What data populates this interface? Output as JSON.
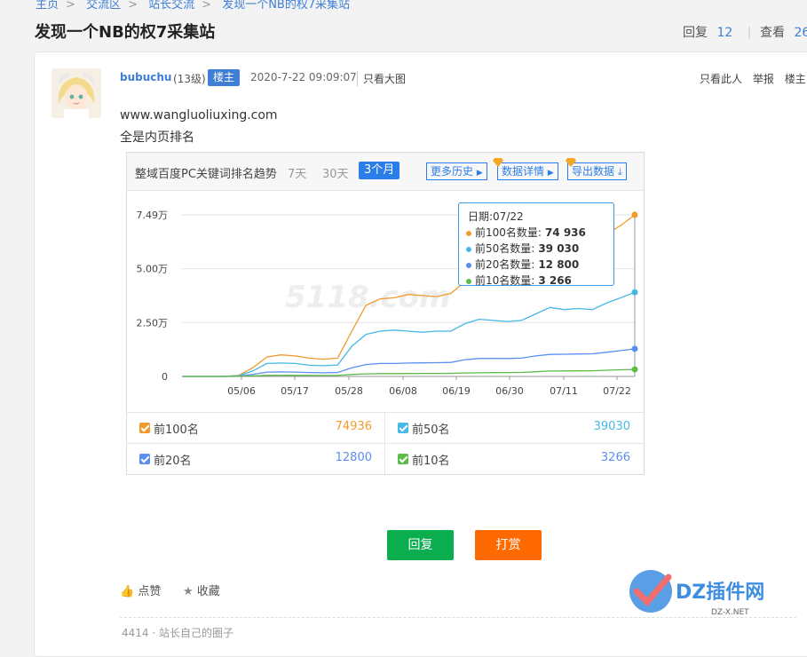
{
  "breadcrumb": [
    "主页",
    "交流区",
    "站长交流",
    "发现一个NB的权7采集站"
  ],
  "thread": {
    "title": "发现一个NB的权7采集站",
    "reply_label": "回复",
    "reply_count": "12",
    "view_label": "查看",
    "view_count": "26"
  },
  "post": {
    "author": "bubuchu",
    "level": "(13级)",
    "owner_badge": "楼主",
    "time": "2020-7-22 09:09:07",
    "view_big": "只看大图",
    "actions": [
      "只看此人",
      "举报",
      "楼主"
    ],
    "lines": [
      "www.wangluoliuxing.com",
      "全是内页排名"
    ]
  },
  "widget": {
    "title": "整域百度PC关键词排名趋势",
    "tabs": [
      "7天",
      "30天",
      "3个月"
    ],
    "active_tab": "3个月",
    "links": [
      "更多历史",
      "数据详情",
      "导出数据"
    ],
    "watermark": "5118.com"
  },
  "chart_data": {
    "type": "line",
    "x_ticks": [
      "05/06",
      "05/17",
      "05/28",
      "06/08",
      "06/19",
      "06/30",
      "07/11",
      "07/22"
    ],
    "y_ticks": [
      "0",
      "2.50万",
      "5.00万",
      "7.49万"
    ],
    "ylim": [
      0,
      74936
    ],
    "x": [
      "04/25",
      "04/30",
      "05/05",
      "05/10",
      "05/13",
      "05/15",
      "05/17",
      "05/19",
      "05/21",
      "05/24",
      "05/26",
      "05/28",
      "05/29",
      "05/31",
      "06/03",
      "06/06",
      "06/09",
      "06/12",
      "06/15",
      "06/17",
      "06/19",
      "06/21",
      "06/24",
      "06/27",
      "06/30",
      "07/02",
      "07/05",
      "07/08",
      "07/11",
      "07/14",
      "07/17",
      "07/20",
      "07/22"
    ],
    "series": [
      {
        "name": "前100名",
        "color": "#f29a2e",
        "values": [
          0,
          0,
          0,
          0,
          500,
          4000,
          9000,
          10000,
          9500,
          8500,
          8000,
          8500,
          21000,
          33000,
          36000,
          36500,
          38000,
          37500,
          37000,
          38500,
          44000,
          46000,
          45000,
          47000,
          48500,
          52000,
          57000,
          60000,
          61000,
          63000,
          66000,
          70000,
          74936
        ]
      },
      {
        "name": "前50名",
        "color": "#45b8e6",
        "values": [
          0,
          0,
          0,
          0,
          300,
          2500,
          6000,
          6200,
          6000,
          5200,
          5000,
          5300,
          14000,
          19500,
          21000,
          21500,
          21000,
          20500,
          21000,
          21000,
          24500,
          26500,
          26000,
          25500,
          26000,
          29000,
          32000,
          31000,
          31500,
          31000,
          34000,
          36500,
          39030
        ]
      },
      {
        "name": "前20名",
        "color": "#5a8ef0",
        "values": [
          0,
          0,
          0,
          0,
          100,
          1000,
          2000,
          2100,
          2000,
          1800,
          1700,
          1800,
          4000,
          5500,
          6000,
          6000,
          6200,
          6300,
          6400,
          6500,
          7800,
          8300,
          8400,
          8300,
          8500,
          9500,
          10200,
          10300,
          10400,
          10500,
          11200,
          12000,
          12800
        ]
      },
      {
        "name": "前10名",
        "color": "#5dbb4a",
        "values": [
          0,
          0,
          0,
          0,
          50,
          300,
          500,
          520,
          510,
          480,
          470,
          480,
          900,
          1200,
          1300,
          1300,
          1350,
          1380,
          1400,
          1450,
          1600,
          1700,
          1750,
          1800,
          1850,
          2200,
          2500,
          2550,
          2600,
          2650,
          2900,
          3100,
          3266
        ]
      }
    ],
    "tooltip": {
      "date_label": "日期:07/22",
      "rows": [
        {
          "label": "前100名数量:",
          "value": "74 936",
          "color": "#f29a2e"
        },
        {
          "label": "前50名数量:",
          "value": "39 030",
          "color": "#45b8e6"
        },
        {
          "label": "前20名数量:",
          "value": "12 800",
          "color": "#5a8ef0"
        },
        {
          "label": "前10名数量:",
          "value": "3 266",
          "color": "#5dbb4a"
        }
      ]
    }
  },
  "legend": [
    {
      "label": "前100名",
      "value": "74936",
      "color": "#f29a2e"
    },
    {
      "label": "前50名",
      "value": "39030",
      "color": "#45b8e6"
    },
    {
      "label": "前20名",
      "value": "12800",
      "color": "#5a8ef0"
    },
    {
      "label": "前10名",
      "value": "3266",
      "color": "#5dbb4a"
    }
  ],
  "buttons": {
    "reply": "回复",
    "reward": "打赏",
    "reply_color": "#0aae4f",
    "reward_color": "#ff6a00"
  },
  "bottom_actions": {
    "like": "点赞",
    "favorite": "收藏"
  },
  "tail_text": "4414 · 站长自己的圈子",
  "logo": {
    "text": "DZ插件网",
    "sub": "DZ-X.NET"
  }
}
